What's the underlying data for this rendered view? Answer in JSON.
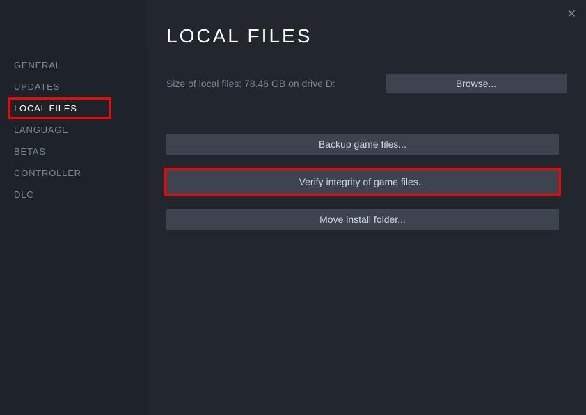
{
  "sidebar": {
    "items": [
      {
        "label": "GENERAL"
      },
      {
        "label": "UPDATES"
      },
      {
        "label": "LOCAL FILES"
      },
      {
        "label": "LANGUAGE"
      },
      {
        "label": "BETAS"
      },
      {
        "label": "CONTROLLER"
      },
      {
        "label": "DLC"
      }
    ]
  },
  "main": {
    "title": "LOCAL FILES",
    "size_info": "Size of local files: 78.46 GB on drive D:",
    "browse_label": "Browse...",
    "backup_label": "Backup game files...",
    "verify_label": "Verify integrity of game files...",
    "move_label": "Move install folder..."
  }
}
